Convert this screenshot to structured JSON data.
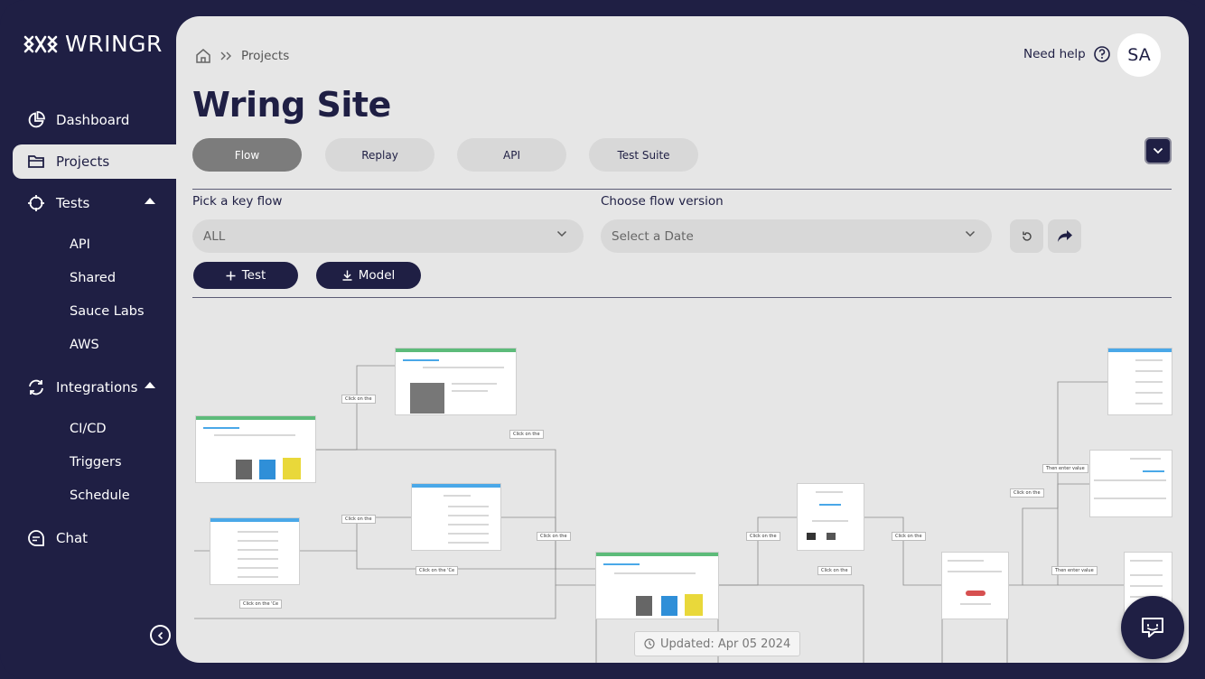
{
  "app": {
    "name": "WRINGR"
  },
  "sidebar": {
    "items": [
      {
        "label": "Dashboard",
        "icon": "pie-chart-icon"
      },
      {
        "label": "Projects",
        "icon": "folder-icon"
      },
      {
        "label": "Tests",
        "icon": "crosshair-icon"
      },
      {
        "label": "Integrations",
        "icon": "sync-icon"
      },
      {
        "label": "Chat",
        "icon": "chat-icon"
      }
    ],
    "tests_sub": [
      "API",
      "Shared",
      "Sauce Labs",
      "AWS"
    ],
    "integrations_sub": [
      "CI/CD",
      "Triggers",
      "Schedule"
    ]
  },
  "header": {
    "breadcrumb": "Projects",
    "help": "Need help",
    "avatar": "SA"
  },
  "page": {
    "title": "Wring Site"
  },
  "tabs": [
    "Flow",
    "Replay",
    "API",
    "Test Suite"
  ],
  "filters": {
    "key_flow_label": "Pick a key flow",
    "key_flow_value": "ALL",
    "version_label": "Choose flow version",
    "version_placeholder": "Select a Date"
  },
  "actions": {
    "test": "Test",
    "model": "Model"
  },
  "flow": {
    "edge_labels": [
      "Click on the",
      "Click on the",
      "Click on the",
      "Click on the 'Ce",
      "Click on the 'Ce",
      "Click on the",
      "Click on the",
      "Click on the",
      "Click on the",
      "Click on the",
      "Then enter value",
      "Then enter value"
    ]
  },
  "footer": {
    "updated": "Updated: Apr 05 2024"
  },
  "colors": {
    "navy": "#1f1f44",
    "panel": "#e6e6e6",
    "tab_active": "#7c7c7c",
    "green_bar": "#5dbb7a",
    "blue_bar": "#4aa8e8"
  }
}
